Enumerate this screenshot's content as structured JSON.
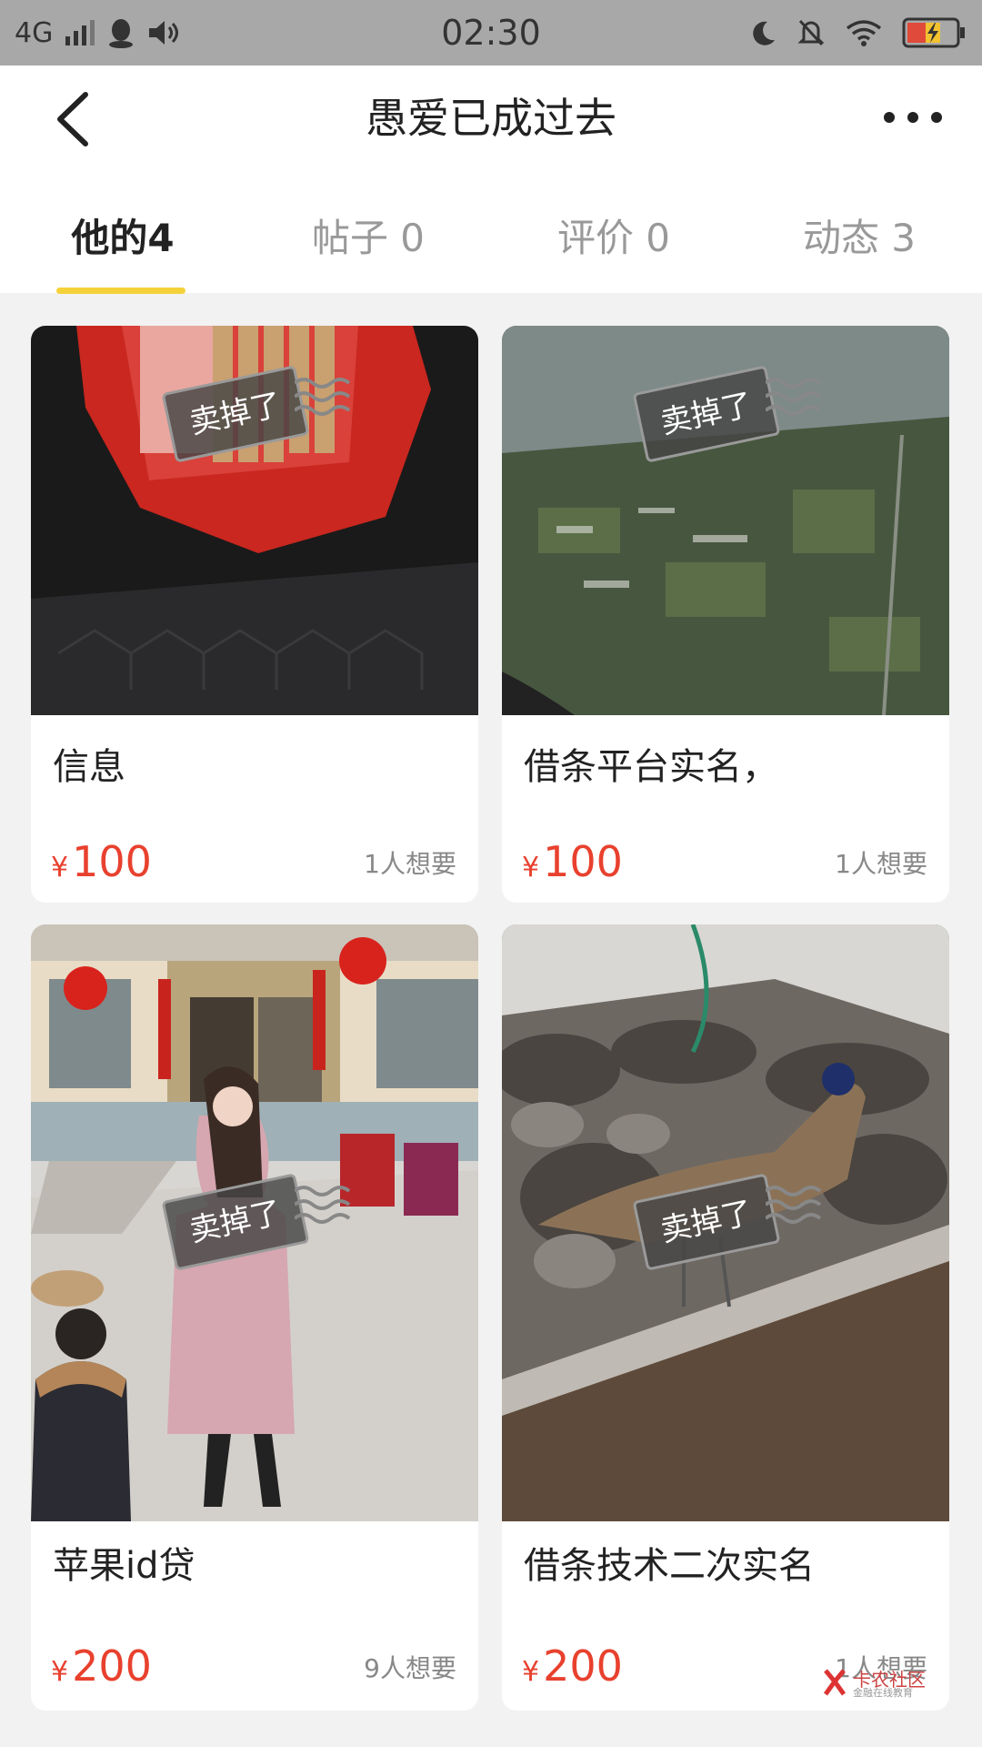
{
  "status_bar": {
    "network": "4G",
    "time": "02:30"
  },
  "header": {
    "title": "愚爱已成过去"
  },
  "tabs": [
    {
      "label": "他的4",
      "active": true
    },
    {
      "label": "帖子 0",
      "active": false
    },
    {
      "label": "评价 0",
      "active": false
    },
    {
      "label": "动态 3",
      "active": false
    }
  ],
  "items": [
    {
      "name": "信息",
      "currency": "¥",
      "price": "100",
      "wants": "1人想要",
      "stamp": "卖掉了"
    },
    {
      "name": "借条平台实名，",
      "currency": "¥",
      "price": "100",
      "wants": "1人想要",
      "stamp": "卖掉了"
    },
    {
      "name": "苹果id贷",
      "currency": "¥",
      "price": "200",
      "wants": "9人想要",
      "stamp": "卖掉了"
    },
    {
      "name": "借条技术二次实名",
      "currency": "¥",
      "price": "200",
      "wants": "1人想要",
      "stamp": "卖掉了"
    }
  ],
  "watermark": {
    "text": "卡农社区",
    "sub": "金融在线教育"
  },
  "colors": {
    "accent_underline": "#f5d13a",
    "price": "#e8412e",
    "status_bar_bg": "#a8a8a8"
  }
}
